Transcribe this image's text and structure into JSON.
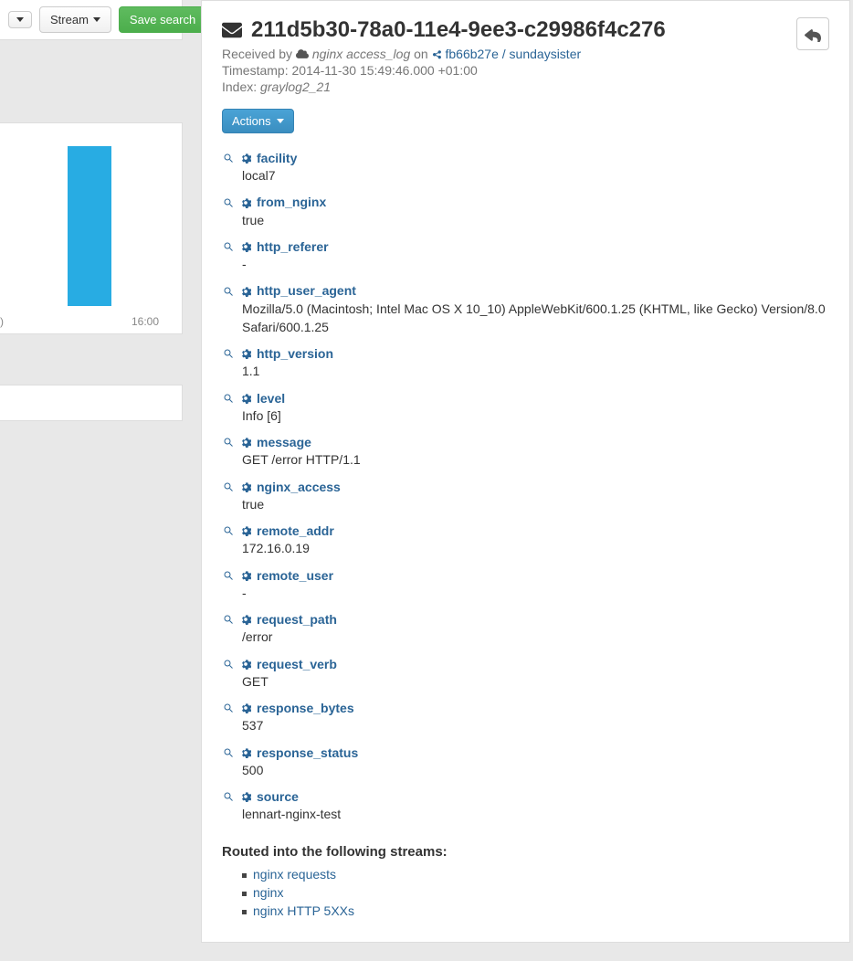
{
  "toolbar": {
    "stream_label": "Stream",
    "save_search_label": "Save search"
  },
  "chart_data": {
    "type": "bar",
    "categories": [
      "16:00"
    ],
    "values": [
      175
    ],
    "ylim": [
      0,
      200
    ],
    "xlabel": "",
    "ylabel": "",
    "title": ""
  },
  "message": {
    "title": "211d5b30-78a0-11e4-9ee3-c29986f4c276",
    "received_prefix": "Received by",
    "input_name": "nginx access_log",
    "received_on": "on",
    "node_link": "fb66b27e / sundaysister",
    "timestamp_label": "Timestamp:",
    "timestamp_value": "2014-11-30 15:49:46.000 +01:00",
    "index_label": "Index:",
    "index_value": "graylog2_21",
    "actions_label": "Actions"
  },
  "fields": [
    {
      "name": "facility",
      "value": "local7"
    },
    {
      "name": "from_nginx",
      "value": "true"
    },
    {
      "name": "http_referer",
      "value": "-"
    },
    {
      "name": "http_user_agent",
      "value": "Mozilla/5.0 (Macintosh; Intel Mac OS X 10_10) AppleWebKit/600.1.25 (KHTML, like Gecko) Version/8.0 Safari/600.1.25"
    },
    {
      "name": "http_version",
      "value": "1.1"
    },
    {
      "name": "level",
      "value": "Info [6]"
    },
    {
      "name": "message",
      "value": "GET /error HTTP/1.1"
    },
    {
      "name": "nginx_access",
      "value": "true"
    },
    {
      "name": "remote_addr",
      "value": "172.16.0.19"
    },
    {
      "name": "remote_user",
      "value": "-"
    },
    {
      "name": "request_path",
      "value": "/error"
    },
    {
      "name": "request_verb",
      "value": "GET"
    },
    {
      "name": "response_bytes",
      "value": "537"
    },
    {
      "name": "response_status",
      "value": "500"
    },
    {
      "name": "source",
      "value": "lennart-nginx-test"
    }
  ],
  "routed": {
    "title": "Routed into the following streams:",
    "streams": [
      "nginx requests",
      "nginx",
      "nginx HTTP 5XXs"
    ]
  }
}
